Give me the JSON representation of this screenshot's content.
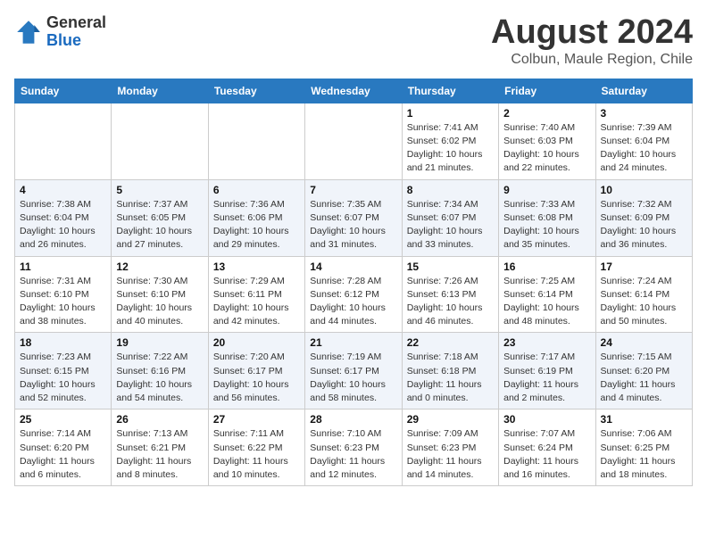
{
  "header": {
    "logo_line1": "General",
    "logo_line2": "Blue",
    "month_title": "August 2024",
    "location": "Colbun, Maule Region, Chile"
  },
  "days_of_week": [
    "Sunday",
    "Monday",
    "Tuesday",
    "Wednesday",
    "Thursday",
    "Friday",
    "Saturday"
  ],
  "weeks": [
    [
      {
        "day": "",
        "info": ""
      },
      {
        "day": "",
        "info": ""
      },
      {
        "day": "",
        "info": ""
      },
      {
        "day": "",
        "info": ""
      },
      {
        "day": "1",
        "info": "Sunrise: 7:41 AM\nSunset: 6:02 PM\nDaylight: 10 hours\nand 21 minutes."
      },
      {
        "day": "2",
        "info": "Sunrise: 7:40 AM\nSunset: 6:03 PM\nDaylight: 10 hours\nand 22 minutes."
      },
      {
        "day": "3",
        "info": "Sunrise: 7:39 AM\nSunset: 6:04 PM\nDaylight: 10 hours\nand 24 minutes."
      }
    ],
    [
      {
        "day": "4",
        "info": "Sunrise: 7:38 AM\nSunset: 6:04 PM\nDaylight: 10 hours\nand 26 minutes."
      },
      {
        "day": "5",
        "info": "Sunrise: 7:37 AM\nSunset: 6:05 PM\nDaylight: 10 hours\nand 27 minutes."
      },
      {
        "day": "6",
        "info": "Sunrise: 7:36 AM\nSunset: 6:06 PM\nDaylight: 10 hours\nand 29 minutes."
      },
      {
        "day": "7",
        "info": "Sunrise: 7:35 AM\nSunset: 6:07 PM\nDaylight: 10 hours\nand 31 minutes."
      },
      {
        "day": "8",
        "info": "Sunrise: 7:34 AM\nSunset: 6:07 PM\nDaylight: 10 hours\nand 33 minutes."
      },
      {
        "day": "9",
        "info": "Sunrise: 7:33 AM\nSunset: 6:08 PM\nDaylight: 10 hours\nand 35 minutes."
      },
      {
        "day": "10",
        "info": "Sunrise: 7:32 AM\nSunset: 6:09 PM\nDaylight: 10 hours\nand 36 minutes."
      }
    ],
    [
      {
        "day": "11",
        "info": "Sunrise: 7:31 AM\nSunset: 6:10 PM\nDaylight: 10 hours\nand 38 minutes."
      },
      {
        "day": "12",
        "info": "Sunrise: 7:30 AM\nSunset: 6:10 PM\nDaylight: 10 hours\nand 40 minutes."
      },
      {
        "day": "13",
        "info": "Sunrise: 7:29 AM\nSunset: 6:11 PM\nDaylight: 10 hours\nand 42 minutes."
      },
      {
        "day": "14",
        "info": "Sunrise: 7:28 AM\nSunset: 6:12 PM\nDaylight: 10 hours\nand 44 minutes."
      },
      {
        "day": "15",
        "info": "Sunrise: 7:26 AM\nSunset: 6:13 PM\nDaylight: 10 hours\nand 46 minutes."
      },
      {
        "day": "16",
        "info": "Sunrise: 7:25 AM\nSunset: 6:14 PM\nDaylight: 10 hours\nand 48 minutes."
      },
      {
        "day": "17",
        "info": "Sunrise: 7:24 AM\nSunset: 6:14 PM\nDaylight: 10 hours\nand 50 minutes."
      }
    ],
    [
      {
        "day": "18",
        "info": "Sunrise: 7:23 AM\nSunset: 6:15 PM\nDaylight: 10 hours\nand 52 minutes."
      },
      {
        "day": "19",
        "info": "Sunrise: 7:22 AM\nSunset: 6:16 PM\nDaylight: 10 hours\nand 54 minutes."
      },
      {
        "day": "20",
        "info": "Sunrise: 7:20 AM\nSunset: 6:17 PM\nDaylight: 10 hours\nand 56 minutes."
      },
      {
        "day": "21",
        "info": "Sunrise: 7:19 AM\nSunset: 6:17 PM\nDaylight: 10 hours\nand 58 minutes."
      },
      {
        "day": "22",
        "info": "Sunrise: 7:18 AM\nSunset: 6:18 PM\nDaylight: 11 hours\nand 0 minutes."
      },
      {
        "day": "23",
        "info": "Sunrise: 7:17 AM\nSunset: 6:19 PM\nDaylight: 11 hours\nand 2 minutes."
      },
      {
        "day": "24",
        "info": "Sunrise: 7:15 AM\nSunset: 6:20 PM\nDaylight: 11 hours\nand 4 minutes."
      }
    ],
    [
      {
        "day": "25",
        "info": "Sunrise: 7:14 AM\nSunset: 6:20 PM\nDaylight: 11 hours\nand 6 minutes."
      },
      {
        "day": "26",
        "info": "Sunrise: 7:13 AM\nSunset: 6:21 PM\nDaylight: 11 hours\nand 8 minutes."
      },
      {
        "day": "27",
        "info": "Sunrise: 7:11 AM\nSunset: 6:22 PM\nDaylight: 11 hours\nand 10 minutes."
      },
      {
        "day": "28",
        "info": "Sunrise: 7:10 AM\nSunset: 6:23 PM\nDaylight: 11 hours\nand 12 minutes."
      },
      {
        "day": "29",
        "info": "Sunrise: 7:09 AM\nSunset: 6:23 PM\nDaylight: 11 hours\nand 14 minutes."
      },
      {
        "day": "30",
        "info": "Sunrise: 7:07 AM\nSunset: 6:24 PM\nDaylight: 11 hours\nand 16 minutes."
      },
      {
        "day": "31",
        "info": "Sunrise: 7:06 AM\nSunset: 6:25 PM\nDaylight: 11 hours\nand 18 minutes."
      }
    ]
  ]
}
